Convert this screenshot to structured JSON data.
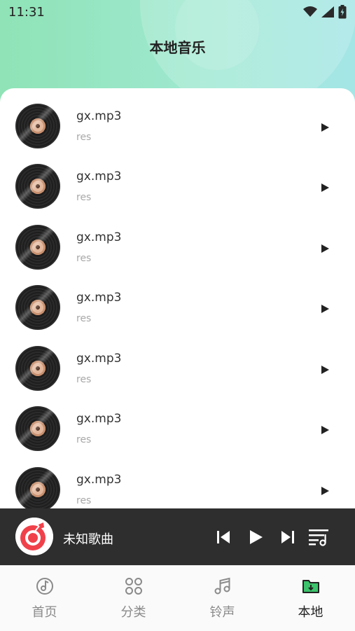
{
  "status_bar": {
    "time": "11:31"
  },
  "header": {
    "title": "本地音乐"
  },
  "songs": [
    {
      "title": "gx.mp3",
      "artist": "res"
    },
    {
      "title": "gx.mp3",
      "artist": "res"
    },
    {
      "title": "gx.mp3",
      "artist": "res"
    },
    {
      "title": "gx.mp3",
      "artist": "res"
    },
    {
      "title": "gx.mp3",
      "artist": "res"
    },
    {
      "title": "gx.mp3",
      "artist": "res"
    },
    {
      "title": "gx.mp3",
      "artist": "res"
    }
  ],
  "player": {
    "title": "未知歌曲"
  },
  "tabs": [
    {
      "label": "首页",
      "icon": "music-note-circle-icon"
    },
    {
      "label": "分类",
      "icon": "category-grid-icon"
    },
    {
      "label": "铃声",
      "icon": "ringtone-note-icon"
    },
    {
      "label": "本地",
      "icon": "local-folder-icon",
      "active": true
    }
  ],
  "colors": {
    "header_gradient_start": "#8fe3b6",
    "header_gradient_end": "#a4e6e6",
    "player_bg": "#2e2e2e",
    "accent_green": "#3cc36b",
    "cover_red": "#f0414a"
  }
}
